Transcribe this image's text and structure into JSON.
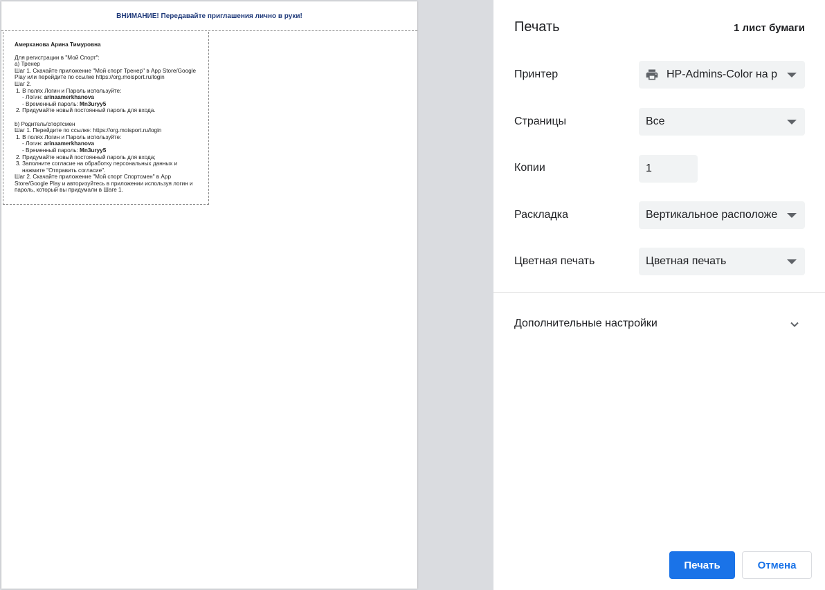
{
  "preview": {
    "notice": "ВНИМАНИЕ! Передавайте приглашения лично в руки!",
    "card": {
      "name": "Амерханова Арина Тимуровна",
      "intro": "Для регистрации в \"Мой Спорт\":",
      "coach_heading": "а) Тренер",
      "coach_step1": "Шаг 1. Скачайте приложение \"Мой спорт Тренер\" в App Store/Google Play или перейдите по ссылке https://org.moisport.ru/login",
      "coach_step2": "Шаг 2.",
      "coach_item1": "1. В полях Логин и Пароль используйте:",
      "login_label": "- Логин: ",
      "login_value": "arinaamerkhanova",
      "password_label": "- Временный пароль: ",
      "password_value": "Mn3uryy5",
      "coach_item2": "2. Придумайте новый постоянный пароль для входа.",
      "parent_heading": "b) Родитель/спортсмен",
      "parent_step1": "Шаг 1. Перейдите по ссылке: https://org.moisport.ru/login",
      "parent_item1": "1. В полях Логин и Пароль используйте:",
      "parent_item2": "2. Придумайте новый постоянный пароль для входа;",
      "parent_item3a": "3. Заполните согласие на обработку персональных данных и",
      "parent_item3b": "нажмите \"Отправить согласие\".",
      "parent_step2": "Шаг 2. Скачайте приложение \"Мой спорт Спортсмен\" в App Store/Google Play и авторизуйтесь в приложении используя логин и пароль, который вы придумали в Шаге 1."
    }
  },
  "panel": {
    "title": "Печать",
    "sheets": "1 лист бумаги",
    "printer_label": "Принтер",
    "printer_value": "HP-Admins-Color на p",
    "pages_label": "Страницы",
    "pages_value": "Все",
    "copies_label": "Копии",
    "copies_value": "1",
    "layout_label": "Раскладка",
    "layout_value": "Вертикальное расположение",
    "color_label": "Цветная печать",
    "color_value": "Цветная печать",
    "more_settings": "Дополнительные настройки",
    "print_button": "Печать",
    "cancel_button": "Отмена"
  },
  "colors": {
    "accent": "#1a73e8",
    "preview_bg": "#dadce0",
    "field_bg": "#f1f3f4",
    "notice_text": "#1f3a7a"
  },
  "icons": {
    "printer": "printer-icon",
    "dropdown": "dropdown-arrow-icon",
    "expand": "chevron-down-icon"
  }
}
